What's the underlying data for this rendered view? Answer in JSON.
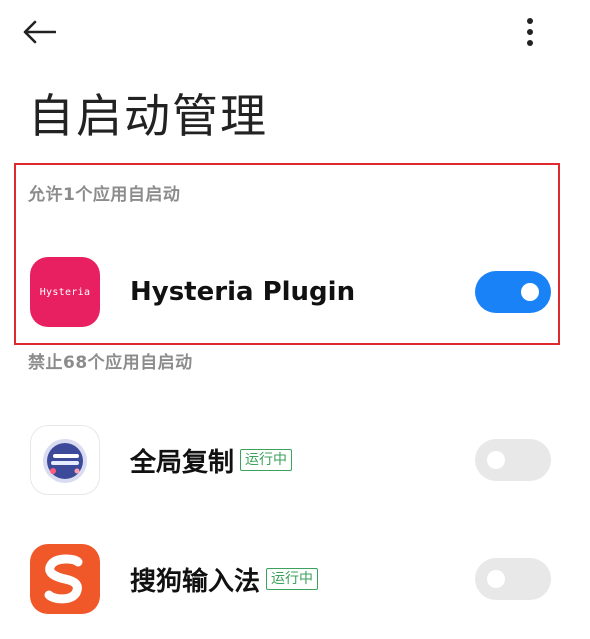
{
  "header": {
    "back_icon": "arrow-left-icon",
    "more_icon": "more-vertical-icon",
    "title": "自启动管理"
  },
  "allowed_section": {
    "header": "允许1个应用自启动",
    "apps": [
      {
        "name": "Hysteria Plugin",
        "icon_text": "Hysteria",
        "icon": "hysteria-app-icon",
        "icon_color": "#e81f61",
        "enabled": true
      }
    ]
  },
  "blocked_section": {
    "header": "禁止68个应用自启动",
    "apps": [
      {
        "name": "全局复制",
        "badge": "运行中",
        "icon": "global-copy-app-icon",
        "enabled": false
      },
      {
        "name": "搜狗输入法",
        "badge": "运行中",
        "icon": "sogou-input-app-icon",
        "icon_color": "#f0582a",
        "enabled": false
      }
    ]
  },
  "colors": {
    "toggle_on": "#1a82f7",
    "toggle_off": "#e8e8e8",
    "badge": "#3aa25a",
    "highlight": "#e0282f"
  }
}
